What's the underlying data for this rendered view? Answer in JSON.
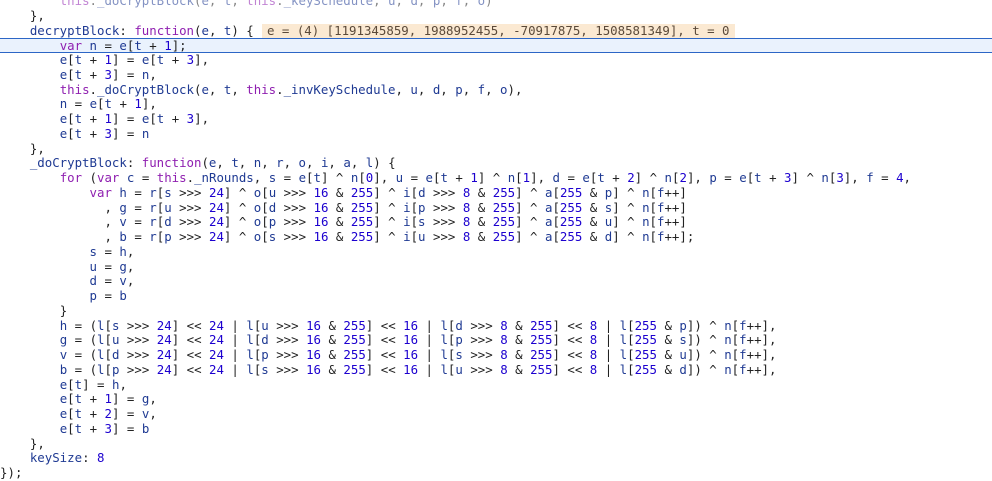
{
  "editor": {
    "lines": [
      "        this._doCryptBlock(e, t, this._keySchedule, u, d, p, f, o)",
      "    },",
      "    decryptBlock: function(e, t) {",
      "        var n = e[t + 1];",
      "        e[t + 1] = e[t + 3],",
      "        e[t + 3] = n,",
      "        this._doCryptBlock(e, t, this._invKeySchedule, u, d, p, f, o),",
      "        n = e[t + 1],",
      "        e[t + 1] = e[t + 3],",
      "        e[t + 3] = n",
      "    },",
      "    _doCryptBlock: function(e, t, n, r, o, i, a, l) {",
      "        for (var c = this._nRounds, s = e[t] ^ n[0], u = e[t + 1] ^ n[1], d = e[t + 2] ^ n[2], p = e[t + 3] ^ n[3], f = 4,",
      "            var h = r[s >>> 24] ^ o[u >>> 16 & 255] ^ i[d >>> 8 & 255] ^ a[255 & p] ^ n[f++]",
      "              , g = r[u >>> 24] ^ o[d >>> 16 & 255] ^ i[p >>> 8 & 255] ^ a[255 & s] ^ n[f++]",
      "              , v = r[d >>> 24] ^ o[p >>> 16 & 255] ^ i[s >>> 8 & 255] ^ a[255 & u] ^ n[f++]",
      "              , b = r[p >>> 24] ^ o[s >>> 16 & 255] ^ i[u >>> 8 & 255] ^ a[255 & d] ^ n[f++];",
      "            s = h,",
      "            u = g,",
      "            d = v,",
      "            p = b",
      "        }",
      "        h = (l[s >>> 24] << 24 | l[u >>> 16 & 255] << 16 | l[d >>> 8 & 255] << 8 | l[255 & p]) ^ n[f++],",
      "        g = (l[u >>> 24] << 24 | l[d >>> 16 & 255] << 16 | l[p >>> 8 & 255] << 8 | l[255 & s]) ^ n[f++],",
      "        v = (l[d >>> 24] << 24 | l[p >>> 16 & 255] << 16 | l[s >>> 8 & 255] << 8 | l[255 & u]) ^ n[f++],",
      "        b = (l[p >>> 24] << 24 | l[s >>> 16 & 255] << 16 | l[u >>> 8 & 255] << 8 | l[255 & d]) ^ n[f++],",
      "        e[t] = h,",
      "        e[t + 1] = g,",
      "        e[t + 2] = v,",
      "        e[t + 3] = b",
      "    },",
      "    keySize: 8",
      "});"
    ],
    "current_line_index": 3,
    "faded_line_index": 0,
    "inline_value": {
      "line_index": 2,
      "text": "e = (4) [1191345859, 1988952455, -70917875, 1508581349], t = 0"
    },
    "colors": {
      "keyword": "#8f1fb0",
      "identifier": "#1f3a93",
      "number": "#1c00cf",
      "current_line_bg": "#eaf2fd",
      "current_line_border": "#2c66c6",
      "inline_value_bg": "#fbe9d2"
    }
  }
}
